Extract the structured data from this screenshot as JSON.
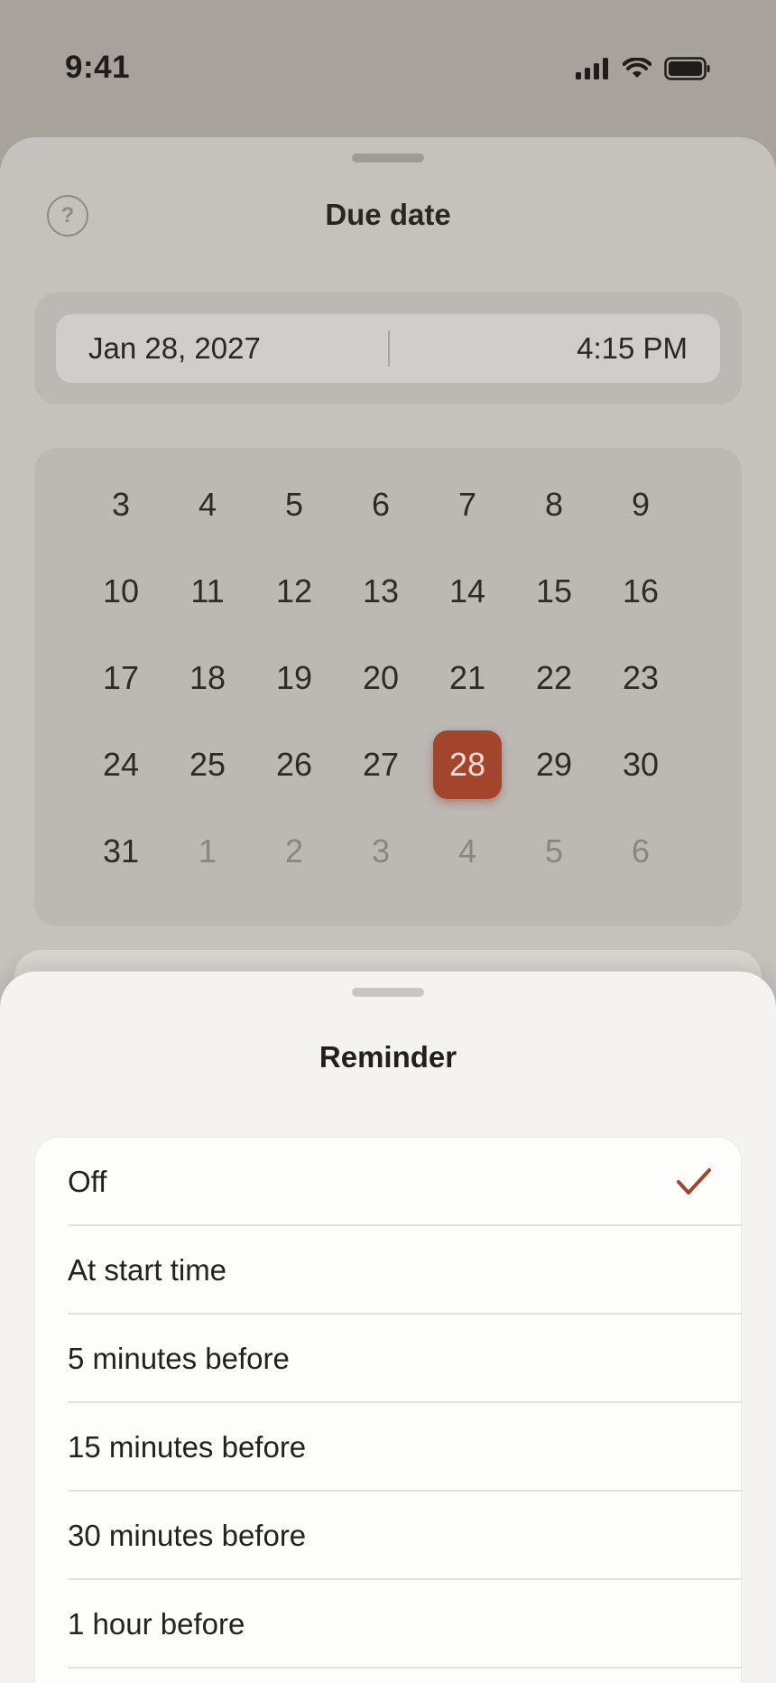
{
  "status_bar": {
    "time": "9:41",
    "icons": [
      "signal-icon",
      "wifi-icon",
      "battery-icon"
    ]
  },
  "due_sheet": {
    "help_label": "?",
    "title": "Due date",
    "date_value": "Jan 28, 2027",
    "time_value": "4:15 PM",
    "calendar": {
      "days": [
        {
          "label": "3",
          "muted": false
        },
        {
          "label": "4",
          "muted": false
        },
        {
          "label": "5",
          "muted": false
        },
        {
          "label": "6",
          "muted": false
        },
        {
          "label": "7",
          "muted": false
        },
        {
          "label": "8",
          "muted": false
        },
        {
          "label": "9",
          "muted": false
        },
        {
          "label": "10",
          "muted": false
        },
        {
          "label": "11",
          "muted": false
        },
        {
          "label": "12",
          "muted": false
        },
        {
          "label": "13",
          "muted": false
        },
        {
          "label": "14",
          "muted": false
        },
        {
          "label": "15",
          "muted": false
        },
        {
          "label": "16",
          "muted": false
        },
        {
          "label": "17",
          "muted": false
        },
        {
          "label": "18",
          "muted": false
        },
        {
          "label": "19",
          "muted": false
        },
        {
          "label": "20",
          "muted": false
        },
        {
          "label": "21",
          "muted": false
        },
        {
          "label": "22",
          "muted": false
        },
        {
          "label": "23",
          "muted": false
        },
        {
          "label": "24",
          "muted": false
        },
        {
          "label": "25",
          "muted": false
        },
        {
          "label": "26",
          "muted": false
        },
        {
          "label": "27",
          "muted": false
        },
        {
          "label": "28",
          "muted": false,
          "selected": true
        },
        {
          "label": "29",
          "muted": false
        },
        {
          "label": "30",
          "muted": false
        },
        {
          "label": "31",
          "muted": false
        },
        {
          "label": "1",
          "muted": true
        },
        {
          "label": "2",
          "muted": true
        },
        {
          "label": "3",
          "muted": true
        },
        {
          "label": "4",
          "muted": true
        },
        {
          "label": "5",
          "muted": true
        },
        {
          "label": "6",
          "muted": true
        }
      ]
    }
  },
  "reminder_sheet": {
    "title": "Reminder",
    "options": [
      {
        "label": "Off",
        "selected": true
      },
      {
        "label": "At start time",
        "selected": false
      },
      {
        "label": "5 minutes before",
        "selected": false
      },
      {
        "label": "15 minutes before",
        "selected": false
      },
      {
        "label": "30 minutes before",
        "selected": false
      },
      {
        "label": "1 hour before",
        "selected": false
      }
    ],
    "check_icon": "checkmark-icon"
  },
  "colors": {
    "accent": "#a3452c",
    "check": "#a3452c"
  }
}
